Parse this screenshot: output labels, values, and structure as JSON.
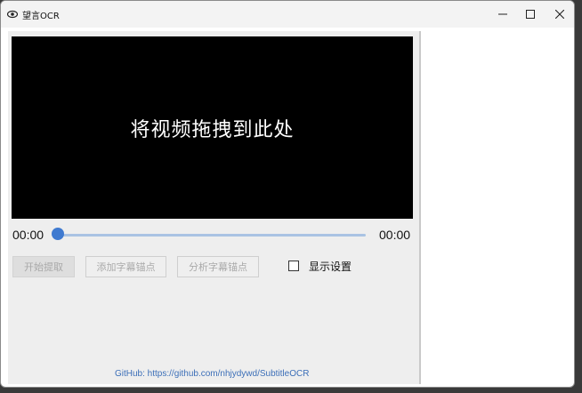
{
  "window": {
    "title": "望言OCR",
    "controls": {
      "minimize": "—",
      "maximize": "☐",
      "close": "✕"
    }
  },
  "video": {
    "drop_hint": "将视频拖拽到此处"
  },
  "playback": {
    "current_time": "00:00",
    "total_time": "00:00",
    "progress": 0
  },
  "actions": {
    "start_label": "开始提取",
    "add_anchor_label": "添加字幕锚点",
    "analyze_anchor_label": "分析字幕锚点",
    "show_settings_label": "显示设置",
    "show_settings_checked": false
  },
  "footer": {
    "github_link": "GitHub: https://github.com/nhjydywd/SubtitleOCR"
  },
  "colors": {
    "accent": "#3f7ad0",
    "track": "#a9c3e3",
    "link": "#3c6fb8"
  }
}
